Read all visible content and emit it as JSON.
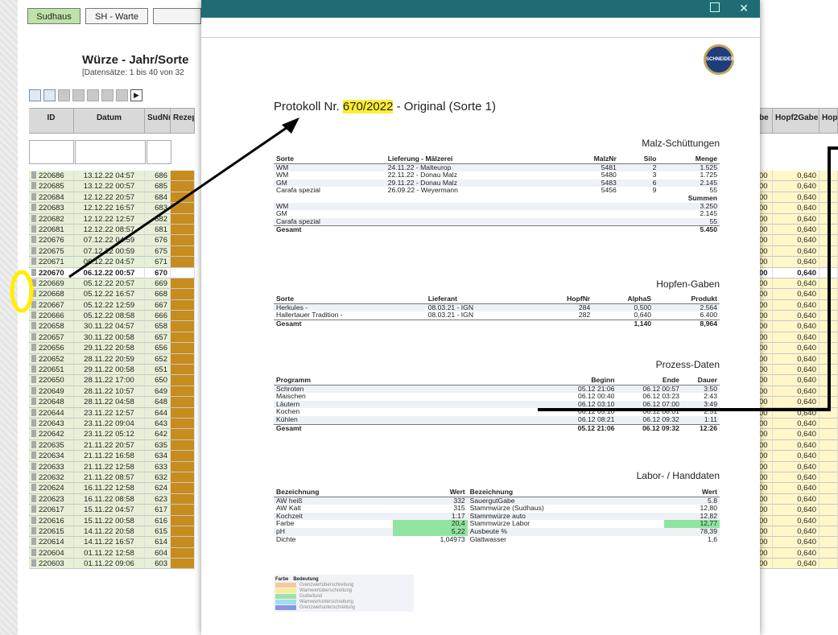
{
  "nav": {
    "sudhaus": "Sudhaus",
    "sh_warte": "SH - Warte"
  },
  "page": {
    "title": "Würze - Jahr/Sorte",
    "subtitle": "[Datensätze: 1 bis 40 von 32"
  },
  "table": {
    "headers": [
      "ID",
      "Datum",
      "SudNr",
      "Rezep"
    ],
    "right_headers": [
      "be",
      "Hopf2Gabe",
      "Hop"
    ],
    "rows": [
      [
        "220686",
        "13.12.22 04:57",
        "686"
      ],
      [
        "220685",
        "13.12.22 00:57",
        "685"
      ],
      [
        "220684",
        "12.12.22 20:57",
        "684"
      ],
      [
        "220683",
        "12.12.22 16:57",
        "683"
      ],
      [
        "220682",
        "12.12.22 12:57",
        "682"
      ],
      [
        "220681",
        "12.12.22 08:57",
        "681"
      ],
      [
        "220676",
        "07.12.22 04:59",
        "676"
      ],
      [
        "220675",
        "07.12.22 00:59",
        "675"
      ],
      [
        "220671",
        "06.12.22 04:57",
        "671"
      ],
      [
        "220670",
        "06.12.22 00:57",
        "670"
      ],
      [
        "220669",
        "05.12.22 20:57",
        "669"
      ],
      [
        "220668",
        "05.12.22 16:57",
        "668"
      ],
      [
        "220667",
        "05.12.22 12:59",
        "667"
      ],
      [
        "220666",
        "05.12.22 08:58",
        "666"
      ],
      [
        "220658",
        "30.11.22 04:57",
        "658"
      ],
      [
        "220657",
        "30.11.22 00:58",
        "657"
      ],
      [
        "220656",
        "29.11.22 20:58",
        "656"
      ],
      [
        "220652",
        "28.11.22 20:59",
        "652"
      ],
      [
        "220651",
        "29.11.22 00:58",
        "651"
      ],
      [
        "220650",
        "28.11.22 17:00",
        "650"
      ],
      [
        "220649",
        "28.11.22 10:57",
        "649"
      ],
      [
        "220648",
        "28.11.22 04:58",
        "648"
      ],
      [
        "220644",
        "23.11.22 12:57",
        "644"
      ],
      [
        "220643",
        "23.11.22 09:04",
        "643"
      ],
      [
        "220642",
        "23.11.22 05:12",
        "642"
      ],
      [
        "220635",
        "21.11.22 20:57",
        "635"
      ],
      [
        "220634",
        "21.11.22 16:58",
        "634"
      ],
      [
        "220633",
        "21.11.22 12:58",
        "633"
      ],
      [
        "220632",
        "21.11.22 08:57",
        "632"
      ],
      [
        "220624",
        "16.11.22 12:58",
        "624"
      ],
      [
        "220623",
        "16.11.22 08:58",
        "623"
      ],
      [
        "220617",
        "15.11.22 04:57",
        "617"
      ],
      [
        "220616",
        "15.11.22 00:58",
        "616"
      ],
      [
        "220615",
        "14.11.22 20:58",
        "615"
      ],
      [
        "220614",
        "14.11.22 16:57",
        "614"
      ],
      [
        "220604",
        "01.11.22 12:58",
        "604"
      ],
      [
        "220603",
        "01.11.22 09:06",
        "603"
      ]
    ],
    "right_col_a": "00",
    "right_col_b": "0,640"
  },
  "report": {
    "logo_text": "SCHNEIDER WEISSE",
    "title_prefix": "Protokoll Nr. ",
    "title_nr": "670/2022",
    "title_suffix": " - Original (Sorte 1)",
    "malz": {
      "section": "Malz-Schüttungen",
      "headers": [
        "Sorte",
        "Lieferung - Mälzerei",
        "MalzNr",
        "Silo",
        "Menge"
      ],
      "rows": [
        [
          "WM",
          "24.11.22 - Malteurop",
          "5481",
          "2",
          "1.525"
        ],
        [
          "WM",
          "22.11.22 - Donau Malz",
          "5480",
          "3",
          "1.725"
        ],
        [
          "GM",
          "29.11.22 - Donau Malz",
          "5483",
          "6",
          "2.145"
        ],
        [
          "Carafa spezial",
          "26.09.22 - Weyermann",
          "5456",
          "9",
          "55"
        ]
      ],
      "summen_label": "Summen",
      "sums": [
        [
          "WM",
          "3.250"
        ],
        [
          "GM",
          "2.145"
        ],
        [
          "Carafa spezial",
          "55"
        ]
      ],
      "total": [
        "Gesamt",
        "5.450"
      ]
    },
    "hopfen": {
      "section": "Hopfen-Gaben",
      "headers": [
        "Sorte",
        "Lieferant",
        "HopfNr",
        "AlphaS",
        "Produkt"
      ],
      "rows": [
        [
          "Herkules -",
          "08.03.21 - IGN",
          "284",
          "0,500",
          "2.564"
        ],
        [
          "Hallertauer Tradition -",
          "08.03.21 - IGN",
          "282",
          "0,640",
          "6.400"
        ]
      ],
      "total": [
        "Gesamt",
        "1,140",
        "8,964"
      ]
    },
    "prozess": {
      "section": "Prozess-Daten",
      "headers": [
        "Programm",
        "Beginn",
        "Ende",
        "Dauer"
      ],
      "rows": [
        [
          "Schroten",
          "05.12 21:06",
          "06.12 00:57",
          "3:50"
        ],
        [
          "Maischen",
          "06.12 00:40",
          "06.12 03:23",
          "2:43"
        ],
        [
          "Läutern",
          "06.12 03:10",
          "06.12 07:00",
          "3:49"
        ],
        [
          "Kochen",
          "06.12 05:10",
          "06.12 08:01",
          "2:51"
        ],
        [
          "Kühlen",
          "06.12 08:21",
          "06.12 09:32",
          "1:11"
        ]
      ],
      "total": [
        "Gesamt",
        "05.12 21:06",
        "06.12 09:32",
        "12:26"
      ]
    },
    "labor": {
      "section": "Labor- / Handdaten",
      "headers": [
        "Bezeichnung",
        "Wert",
        "Bezeichnung",
        "Wert"
      ],
      "rows": [
        [
          "AW heiß",
          "332",
          "SauergutGabe",
          "5.8"
        ],
        [
          "AW Kalt",
          "315",
          "Stammwürze (Sudhaus)",
          "12,80"
        ],
        [
          "Kochzeit",
          "1:17",
          "Stammwürze auto",
          "12,82"
        ],
        [
          "Farbe",
          "20,4",
          "Stammwürze Labor",
          "12,77"
        ],
        [
          "pH",
          "5,22",
          "Ausbeute %",
          "78,39"
        ],
        [
          "Dichte",
          "1,04973",
          "Glattwasser",
          "1,6"
        ]
      ]
    },
    "legend": {
      "headers": [
        "Farbe",
        "Bedeutung"
      ],
      "items": [
        {
          "label": "Grenzwertüberschreitung",
          "color": "#f6c99a"
        },
        {
          "label": "Warnwertüberschreitung",
          "color": "#f7ec9a"
        },
        {
          "label": "Gutbefund",
          "color": "#9fe3a8"
        },
        {
          "label": "Warnwertunterschreitung",
          "color": "#9fdcef"
        },
        {
          "label": "Grenzwertunterschreitung",
          "color": "#8a95e0"
        }
      ]
    }
  },
  "colors": {
    "accent": "#1f6d73",
    "highlight": "#ffee33",
    "rezept": "#c78c1e",
    "good": "#8fe4a0"
  }
}
